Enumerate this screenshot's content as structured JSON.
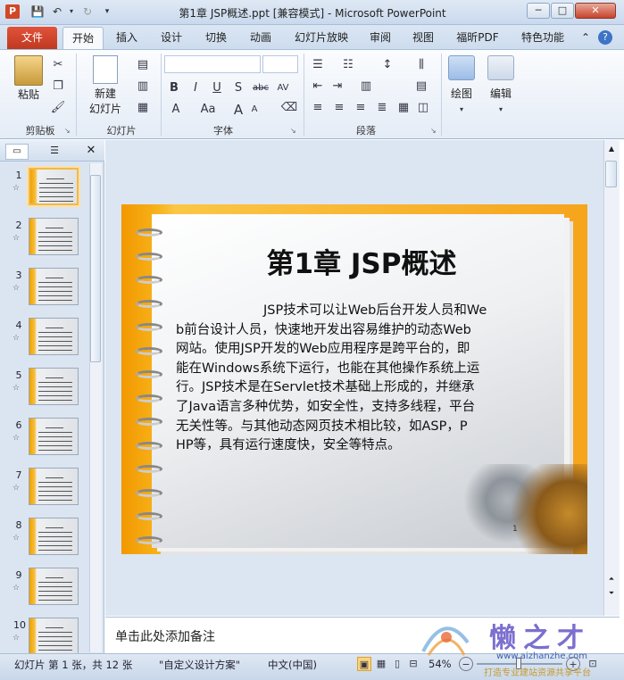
{
  "window": {
    "title": "第1章  JSP概述.ppt [兼容模式] - Microsoft PowerPoint",
    "app_icon": "P",
    "controls": {
      "minimize": "─",
      "maximize": "□",
      "close": "✕"
    }
  },
  "tabs": [
    {
      "label": "文件",
      "active": false
    },
    {
      "label": "开始",
      "active": true
    },
    {
      "label": "插入"
    },
    {
      "label": "设计"
    },
    {
      "label": "切换"
    },
    {
      "label": "动画"
    },
    {
      "label": "幻灯片放映"
    },
    {
      "label": "审阅"
    },
    {
      "label": "视图"
    },
    {
      "label": "福昕PDF"
    },
    {
      "label": "特色功能"
    }
  ],
  "ribbon": {
    "groups": [
      {
        "label": "剪贴板",
        "paste": "粘贴"
      },
      {
        "label": "幻灯片",
        "new_slide": "新建\n幻灯片"
      },
      {
        "label": "字体"
      },
      {
        "label": "段落"
      },
      {
        "label": "绘图",
        "button": "绘图"
      },
      {
        "label": "编辑",
        "button": "编辑"
      }
    ],
    "new_slide_line1": "新建",
    "new_slide_line2": "幻灯片",
    "font_buttons": [
      "B",
      "I",
      "U",
      "S",
      "abc",
      "AV",
      "A",
      "Aa",
      "A",
      "A"
    ]
  },
  "thumbnails": [
    {
      "number": "1",
      "selected": true
    },
    {
      "number": "2"
    },
    {
      "number": "3"
    },
    {
      "number": "4"
    },
    {
      "number": "5"
    },
    {
      "number": "6"
    },
    {
      "number": "7"
    },
    {
      "number": "8"
    },
    {
      "number": "9"
    },
    {
      "number": "10"
    }
  ],
  "slide": {
    "title": "第1章  JSP概述",
    "body_lines": [
      "JSP技术可以让Web后台开发人员和We",
      "b前台设计人员，快速地开发出容易维护的动态Web",
      "网站。使用JSP开发的Web应用程序是跨平台的，即",
      "能在Windows系统下运行，也能在其他操作系统上运",
      "行。JSP技术是在Servlet技术基础上形成的，并继承",
      "了Java语言多种优势，如安全性，支持多线程，平台",
      "无关性等。与其他动态网页技术相比较，如ASP，P",
      "HP等，具有运行速度快，安全等特点。"
    ],
    "page_number": "1"
  },
  "notes": {
    "placeholder": "单击此处添加备注"
  },
  "status": {
    "slide_info": "幻灯片 第 1 张，共 12 张",
    "theme": "\"自定义设计方案\"",
    "language": "中文(中国)",
    "zoom": "54%"
  },
  "watermark": {
    "mark": "懒之才",
    "url": "www.aizhanzhe.com",
    "slogan": "打造专业建站资源共享平台"
  },
  "colors": {
    "file_tab": "#c13821",
    "slide_orange": "#f39800",
    "ribbon_bg": "#e4ecf6"
  }
}
